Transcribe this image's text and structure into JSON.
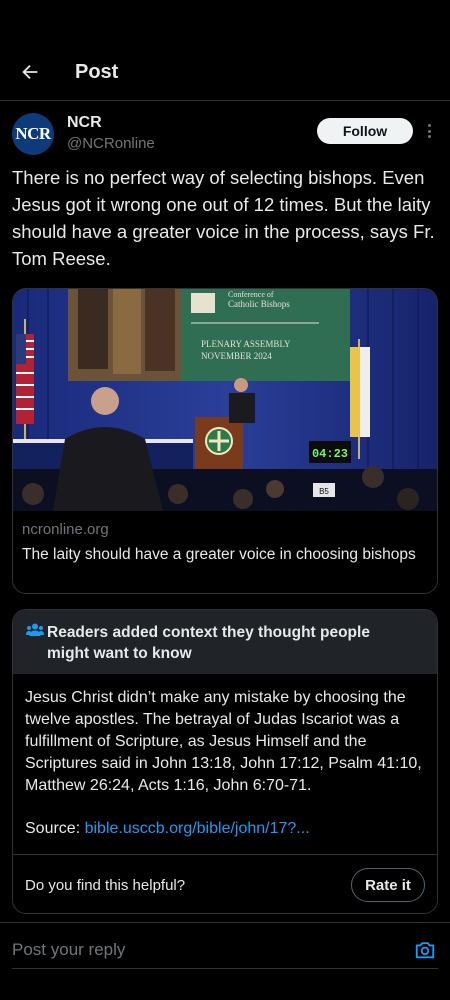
{
  "header": {
    "title": "Post"
  },
  "author": {
    "avatar_text": "NCR",
    "name": "NCR",
    "handle": "@NCRonline",
    "follow_label": "Follow"
  },
  "tweet": {
    "text": "There is no perfect way of selecting bishops. Even Jesus got it wrong one out of 12 times. But the laity should have a greater voice in the process, says Fr. Tom Reese."
  },
  "card": {
    "image": {
      "screen_line1": "Conference of",
      "screen_line2": "Catholic Bishops",
      "screen_line3": "PLENARY ASSEMBLY",
      "screen_line4": "NOVEMBER 2024",
      "timer": "04:23",
      "table_number": "B5"
    },
    "domain": "ncronline.org",
    "title": "The laity should have a greater voice in choosing bishops"
  },
  "community_note": {
    "heading": "Readers added context they thought people might want to know",
    "body": "Jesus Christ didn’t make any mistake by choosing the twelve apostles. The betrayal of Judas Iscariot was a fulfillment of Scripture, as Jesus Himself and the Scriptures said in John 13:18, John 17:12, Psalm 41:10, Matthew 26:24, Acts 1:16, John 6:70-71.",
    "source_label": "Source: ",
    "source_link": "bible.usccb.org/bible/john/17?...",
    "helpful_question": "Do you find this helpful?",
    "rate_label": "Rate it"
  },
  "reply": {
    "placeholder": "Post your reply"
  },
  "colors": {
    "background": "#000000",
    "text": "#e7e9ea",
    "muted": "#71767b",
    "link": "#1d9bf0",
    "border": "#2f3336"
  }
}
